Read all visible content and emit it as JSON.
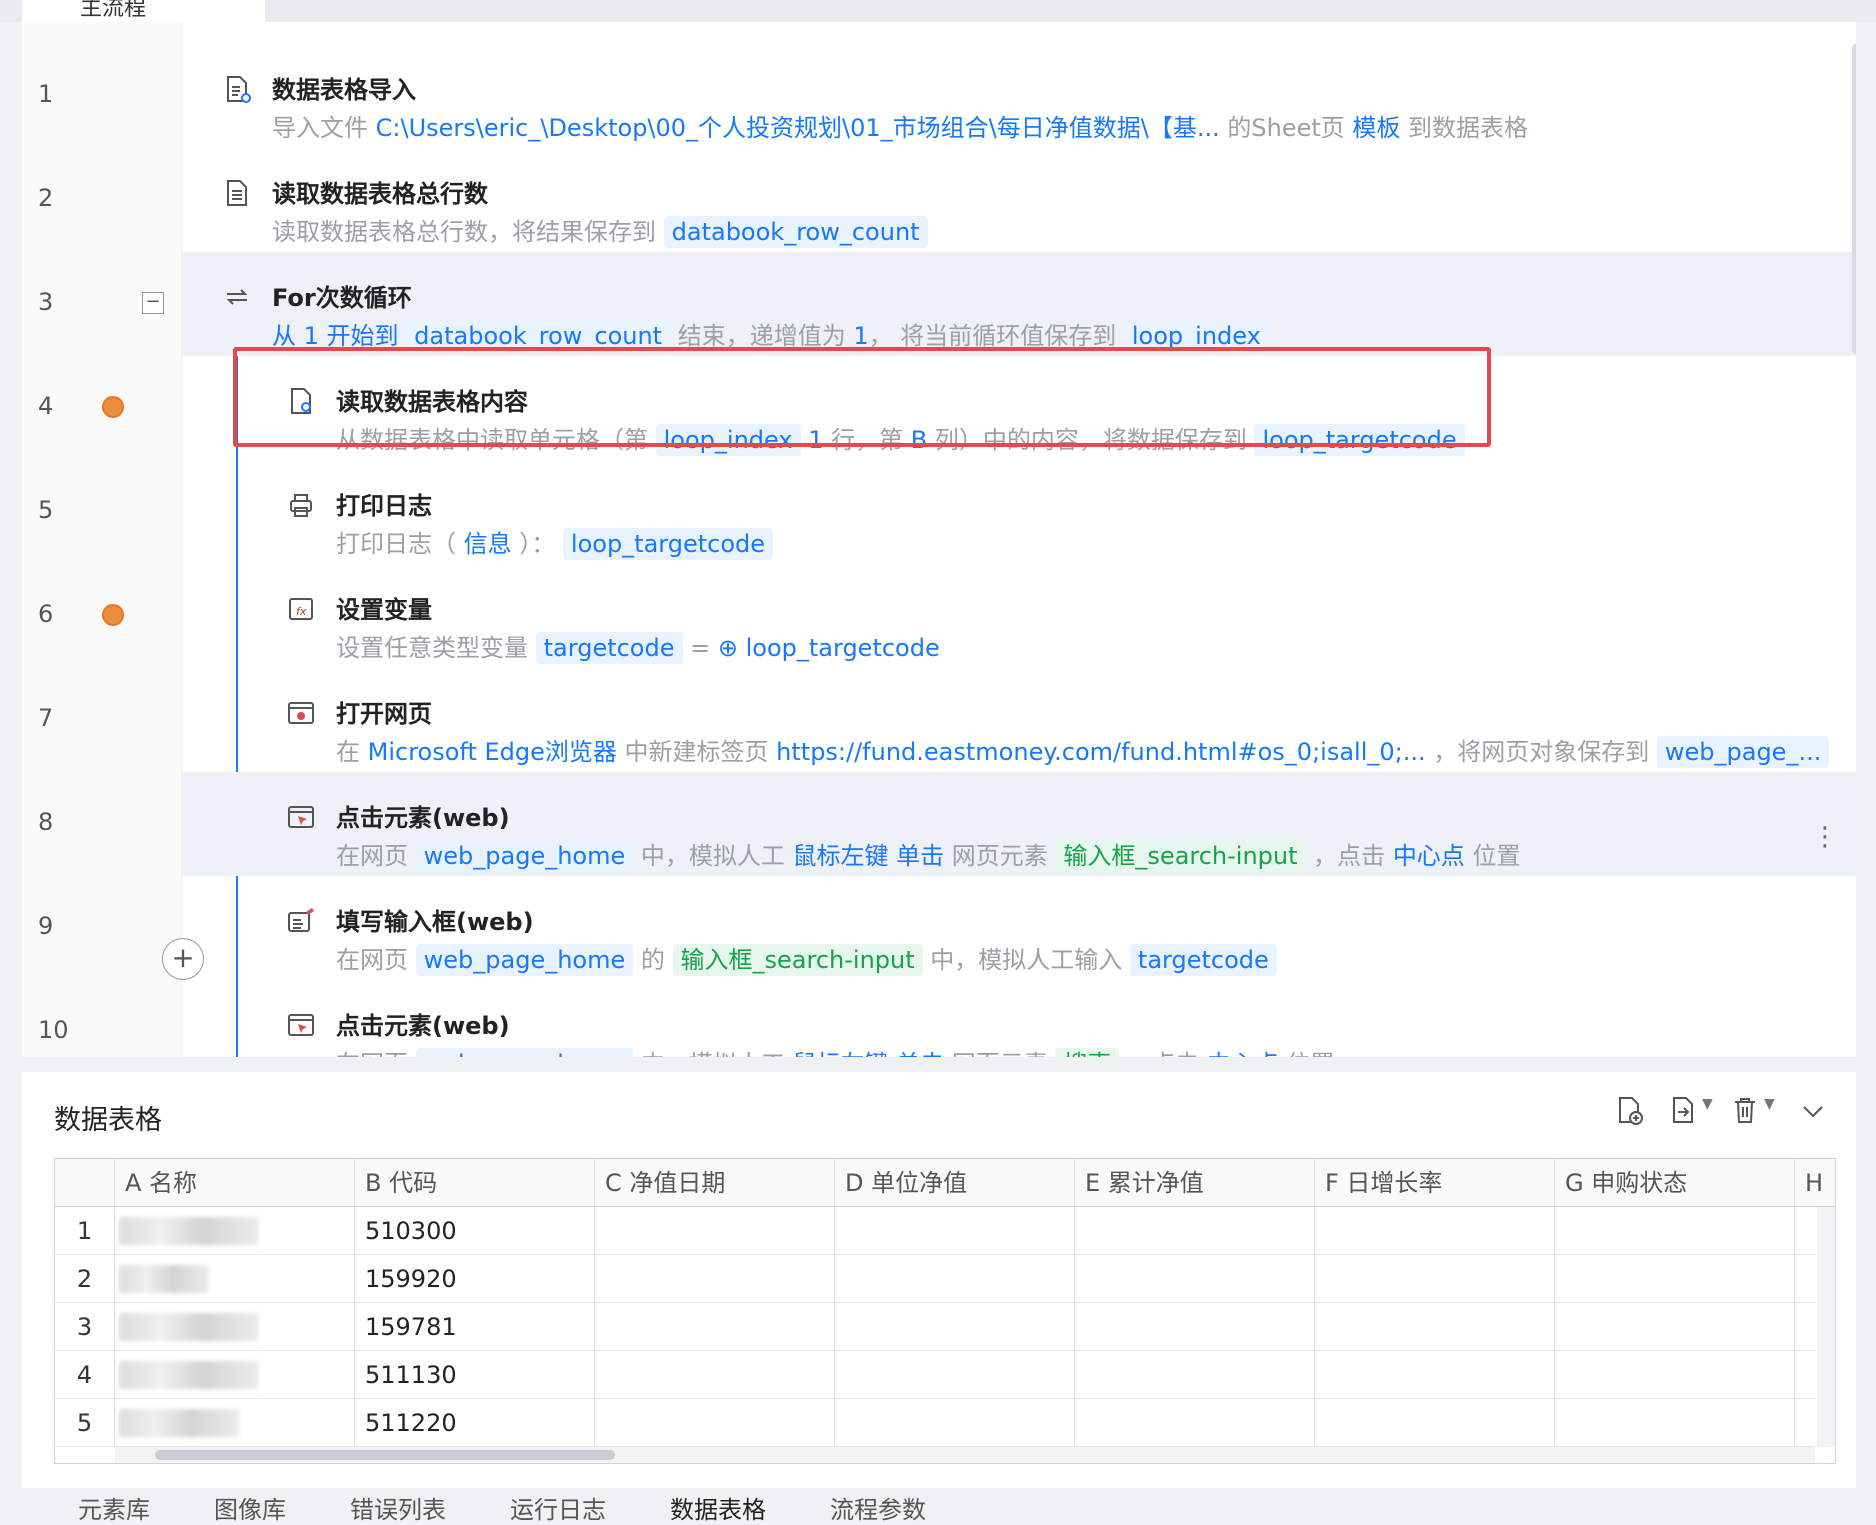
{
  "top_tab": {
    "label": "主流程"
  },
  "flow": {
    "line_numbers": [
      "1",
      "2",
      "3",
      "4",
      "5",
      "6",
      "7",
      "8",
      "9",
      "10"
    ],
    "steps": [
      {
        "title": "数据表格导入",
        "desc": [
          [
            "p",
            "导入文件 "
          ],
          [
            "k",
            "C:\\Users\\eric_\\Desktop\\00_个人投资规划\\01_市场组合\\每日净值数据\\【基..."
          ],
          [
            "p",
            " 的Sheet页 "
          ],
          [
            "k",
            "模板"
          ],
          [
            "p",
            " 到数据表格"
          ]
        ]
      },
      {
        "title": "读取数据表格总行数",
        "desc": [
          [
            "p",
            "读取数据表格总行数，将结果保存到 "
          ],
          [
            "v",
            "databook_row_count"
          ]
        ]
      },
      {
        "title": "For次数循环",
        "desc": [
          [
            "k",
            "从 1 开始到 "
          ],
          [
            "v",
            "databook_row_count"
          ],
          [
            "p",
            " 结束，递增值为 "
          ],
          [
            "k",
            "1"
          ],
          [
            "p",
            "， 将当前循环值保存到 "
          ],
          [
            "v",
            "loop_index"
          ]
        ]
      },
      {
        "title": "读取数据表格内容",
        "desc": [
          [
            "p",
            "从数据表格中读取单元格（第 "
          ],
          [
            "v",
            "loop_index"
          ],
          [
            "k",
            " 1 "
          ],
          [
            "p",
            "行，第 "
          ],
          [
            "k",
            "B"
          ],
          [
            "p",
            " 列）中的内容，将数据保存到 "
          ],
          [
            "v",
            "loop_targetcode"
          ]
        ]
      },
      {
        "title": "打印日志",
        "desc": [
          [
            "p",
            "打印日志（ "
          ],
          [
            "k",
            "信息"
          ],
          [
            "p",
            " ）： "
          ],
          [
            "v",
            "loop_targetcode"
          ]
        ]
      },
      {
        "title": "设置变量",
        "desc": [
          [
            "p",
            "设置任意类型变量 "
          ],
          [
            "v",
            "targetcode"
          ],
          [
            "p",
            " = "
          ],
          [
            "k",
            "⊕ loop_targetcode"
          ]
        ]
      },
      {
        "title": "打开网页",
        "desc": [
          [
            "p",
            "在 "
          ],
          [
            "k",
            "Microsoft Edge浏览器"
          ],
          [
            "p",
            " 中新建标签页 "
          ],
          [
            "k",
            "https://fund.eastmoney.com/fund.html#os_0;isall_0;..."
          ],
          [
            "p",
            " ，将网页对象保存到 "
          ],
          [
            "v",
            "web_page_..."
          ]
        ]
      },
      {
        "title": "点击元素(web)",
        "desc": [
          [
            "p",
            "在网页 "
          ],
          [
            "v",
            "web_page_home"
          ],
          [
            "p",
            " 中，模拟人工 "
          ],
          [
            "k",
            "鼠标左键 单击"
          ],
          [
            "p",
            " 网页元素 "
          ],
          [
            "g",
            "输入框_search-input"
          ],
          [
            "p",
            " ，点击 "
          ],
          [
            "k",
            "中心点"
          ],
          [
            "p",
            " 位置"
          ]
        ]
      },
      {
        "title": "填写输入框(web)",
        "desc": [
          [
            "p",
            "在网页 "
          ],
          [
            "v",
            "web_page_home"
          ],
          [
            "p",
            " 的 "
          ],
          [
            "g",
            "输入框_search-input"
          ],
          [
            "p",
            " 中，模拟人工输入 "
          ],
          [
            "v",
            "targetcode"
          ]
        ]
      },
      {
        "title": "点击元素(web)",
        "desc": [
          [
            "p",
            "在网页 "
          ],
          [
            "v",
            "web_page_home"
          ],
          [
            "p",
            " 中，模拟人工 "
          ],
          [
            "k",
            "鼠标左键 单击"
          ],
          [
            "p",
            " 网页元素 "
          ],
          [
            "g",
            "搜索"
          ],
          [
            "p",
            " ，点击 "
          ],
          [
            "k",
            "中心点"
          ],
          [
            "p",
            " 位置"
          ]
        ]
      }
    ]
  },
  "table": {
    "title": "数据表格",
    "columns": [
      "A 名称",
      "B 代码",
      "C 净值日期",
      "D 单位净值",
      "E 累计净值",
      "F 日增长率",
      "G 申购状态",
      "H"
    ],
    "rows": [
      {
        "n": "1",
        "code": "510300"
      },
      {
        "n": "2",
        "code": "159920"
      },
      {
        "n": "3",
        "code": "159781"
      },
      {
        "n": "4",
        "code": "511130"
      },
      {
        "n": "5",
        "code": "511220"
      }
    ]
  },
  "bottom_tabs": [
    "元素库",
    "图像库",
    "错误列表",
    "运行日志",
    "数据表格",
    "流程参数"
  ],
  "colors": {
    "accent": "#1677ff",
    "breakpoint": "#f08a3c",
    "highlight_box": "#e5484d",
    "element": "#16a34a"
  }
}
